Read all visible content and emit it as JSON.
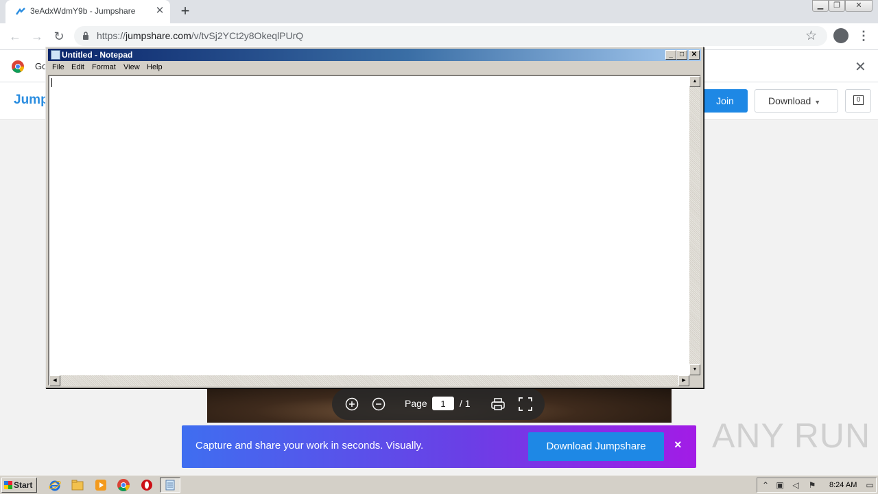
{
  "browser": {
    "tab": {
      "title": "3eAdxWdmY9b - Jumpshare"
    },
    "url": {
      "prefix": "https://",
      "host": "jumpshare.com",
      "path": "/v/tvSj2YCt2y8OkeqlPUrQ"
    },
    "infobar": {
      "text": "Go"
    }
  },
  "site": {
    "brand": "Jump",
    "join_label": "Join",
    "download_label": "Download",
    "comments_count": "0"
  },
  "viewer": {
    "page_label": "Page",
    "page_current": "1",
    "page_total": "/ 1"
  },
  "promo": {
    "text": "Capture and share your work in seconds. Visually.",
    "button_label": "Download Jumpshare",
    "close": "×"
  },
  "notepad": {
    "title": "Untitled - Notepad",
    "menu": [
      "File",
      "Edit",
      "Format",
      "View",
      "Help"
    ],
    "content": ""
  },
  "taskbar": {
    "start_label": "Start",
    "clock": "8:24 AM"
  },
  "watermark": "ANY RUN",
  "colors": {
    "jumpshare_blue": "#1e88e5",
    "promo_gradient_start": "#3f6ef0",
    "promo_gradient_end": "#a21ce6",
    "notepad_titlebar": "#0a246a"
  }
}
